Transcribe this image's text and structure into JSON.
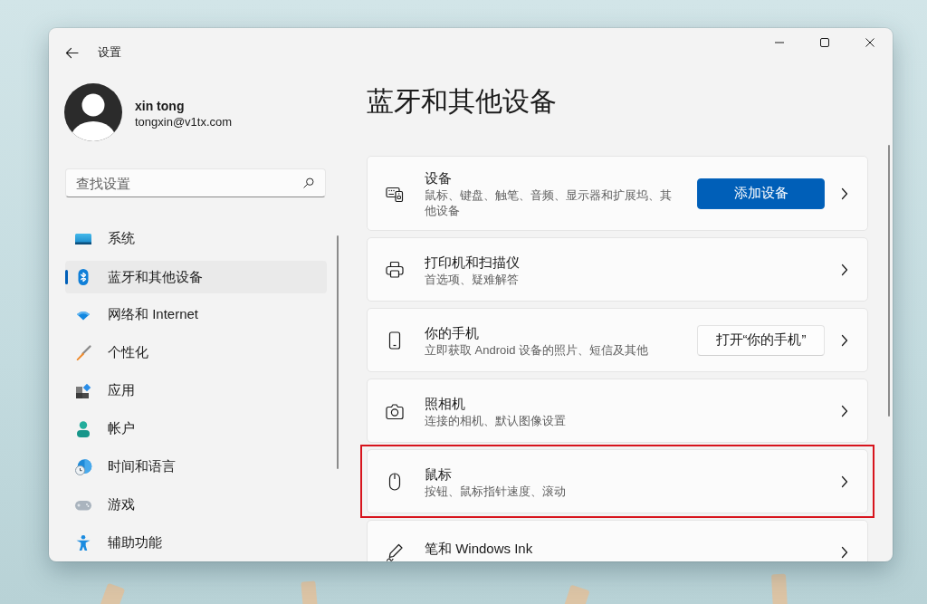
{
  "window": {
    "title": "设置"
  },
  "account": {
    "name": "xin tong",
    "email": "tongxin@v1tx.com"
  },
  "search": {
    "placeholder": "查找设置"
  },
  "sidebar": {
    "items": [
      {
        "label": "系统",
        "selected": false
      },
      {
        "label": "蓝牙和其他设备",
        "selected": true
      },
      {
        "label": "网络和 Internet",
        "selected": false
      },
      {
        "label": "个性化",
        "selected": false
      },
      {
        "label": "应用",
        "selected": false
      },
      {
        "label": "帐户",
        "selected": false
      },
      {
        "label": "时间和语言",
        "selected": false
      },
      {
        "label": "游戏",
        "selected": false
      },
      {
        "label": "辅助功能",
        "selected": false
      }
    ]
  },
  "page": {
    "title": "蓝牙和其他设备",
    "cards": [
      {
        "title": "设备",
        "subtitle": "鼠标、键盘、触笔、音频、显示器和扩展坞、其他设备",
        "button": {
          "label": "添加设备",
          "kind": "primary"
        },
        "highlighted": false
      },
      {
        "title": "打印机和扫描仪",
        "subtitle": "首选项、疑难解答",
        "highlighted": false
      },
      {
        "title": "你的手机",
        "subtitle": "立即获取 Android 设备的照片、短信及其他",
        "button": {
          "label": "打开“你的手机”",
          "kind": "secondary"
        },
        "highlighted": false
      },
      {
        "title": "照相机",
        "subtitle": "连接的相机、默认图像设置",
        "highlighted": false
      },
      {
        "title": "鼠标",
        "subtitle": "按钮、鼠标指针速度、滚动",
        "highlighted": true
      },
      {
        "title": "笔和 Windows Ink",
        "highlighted": false
      }
    ]
  }
}
